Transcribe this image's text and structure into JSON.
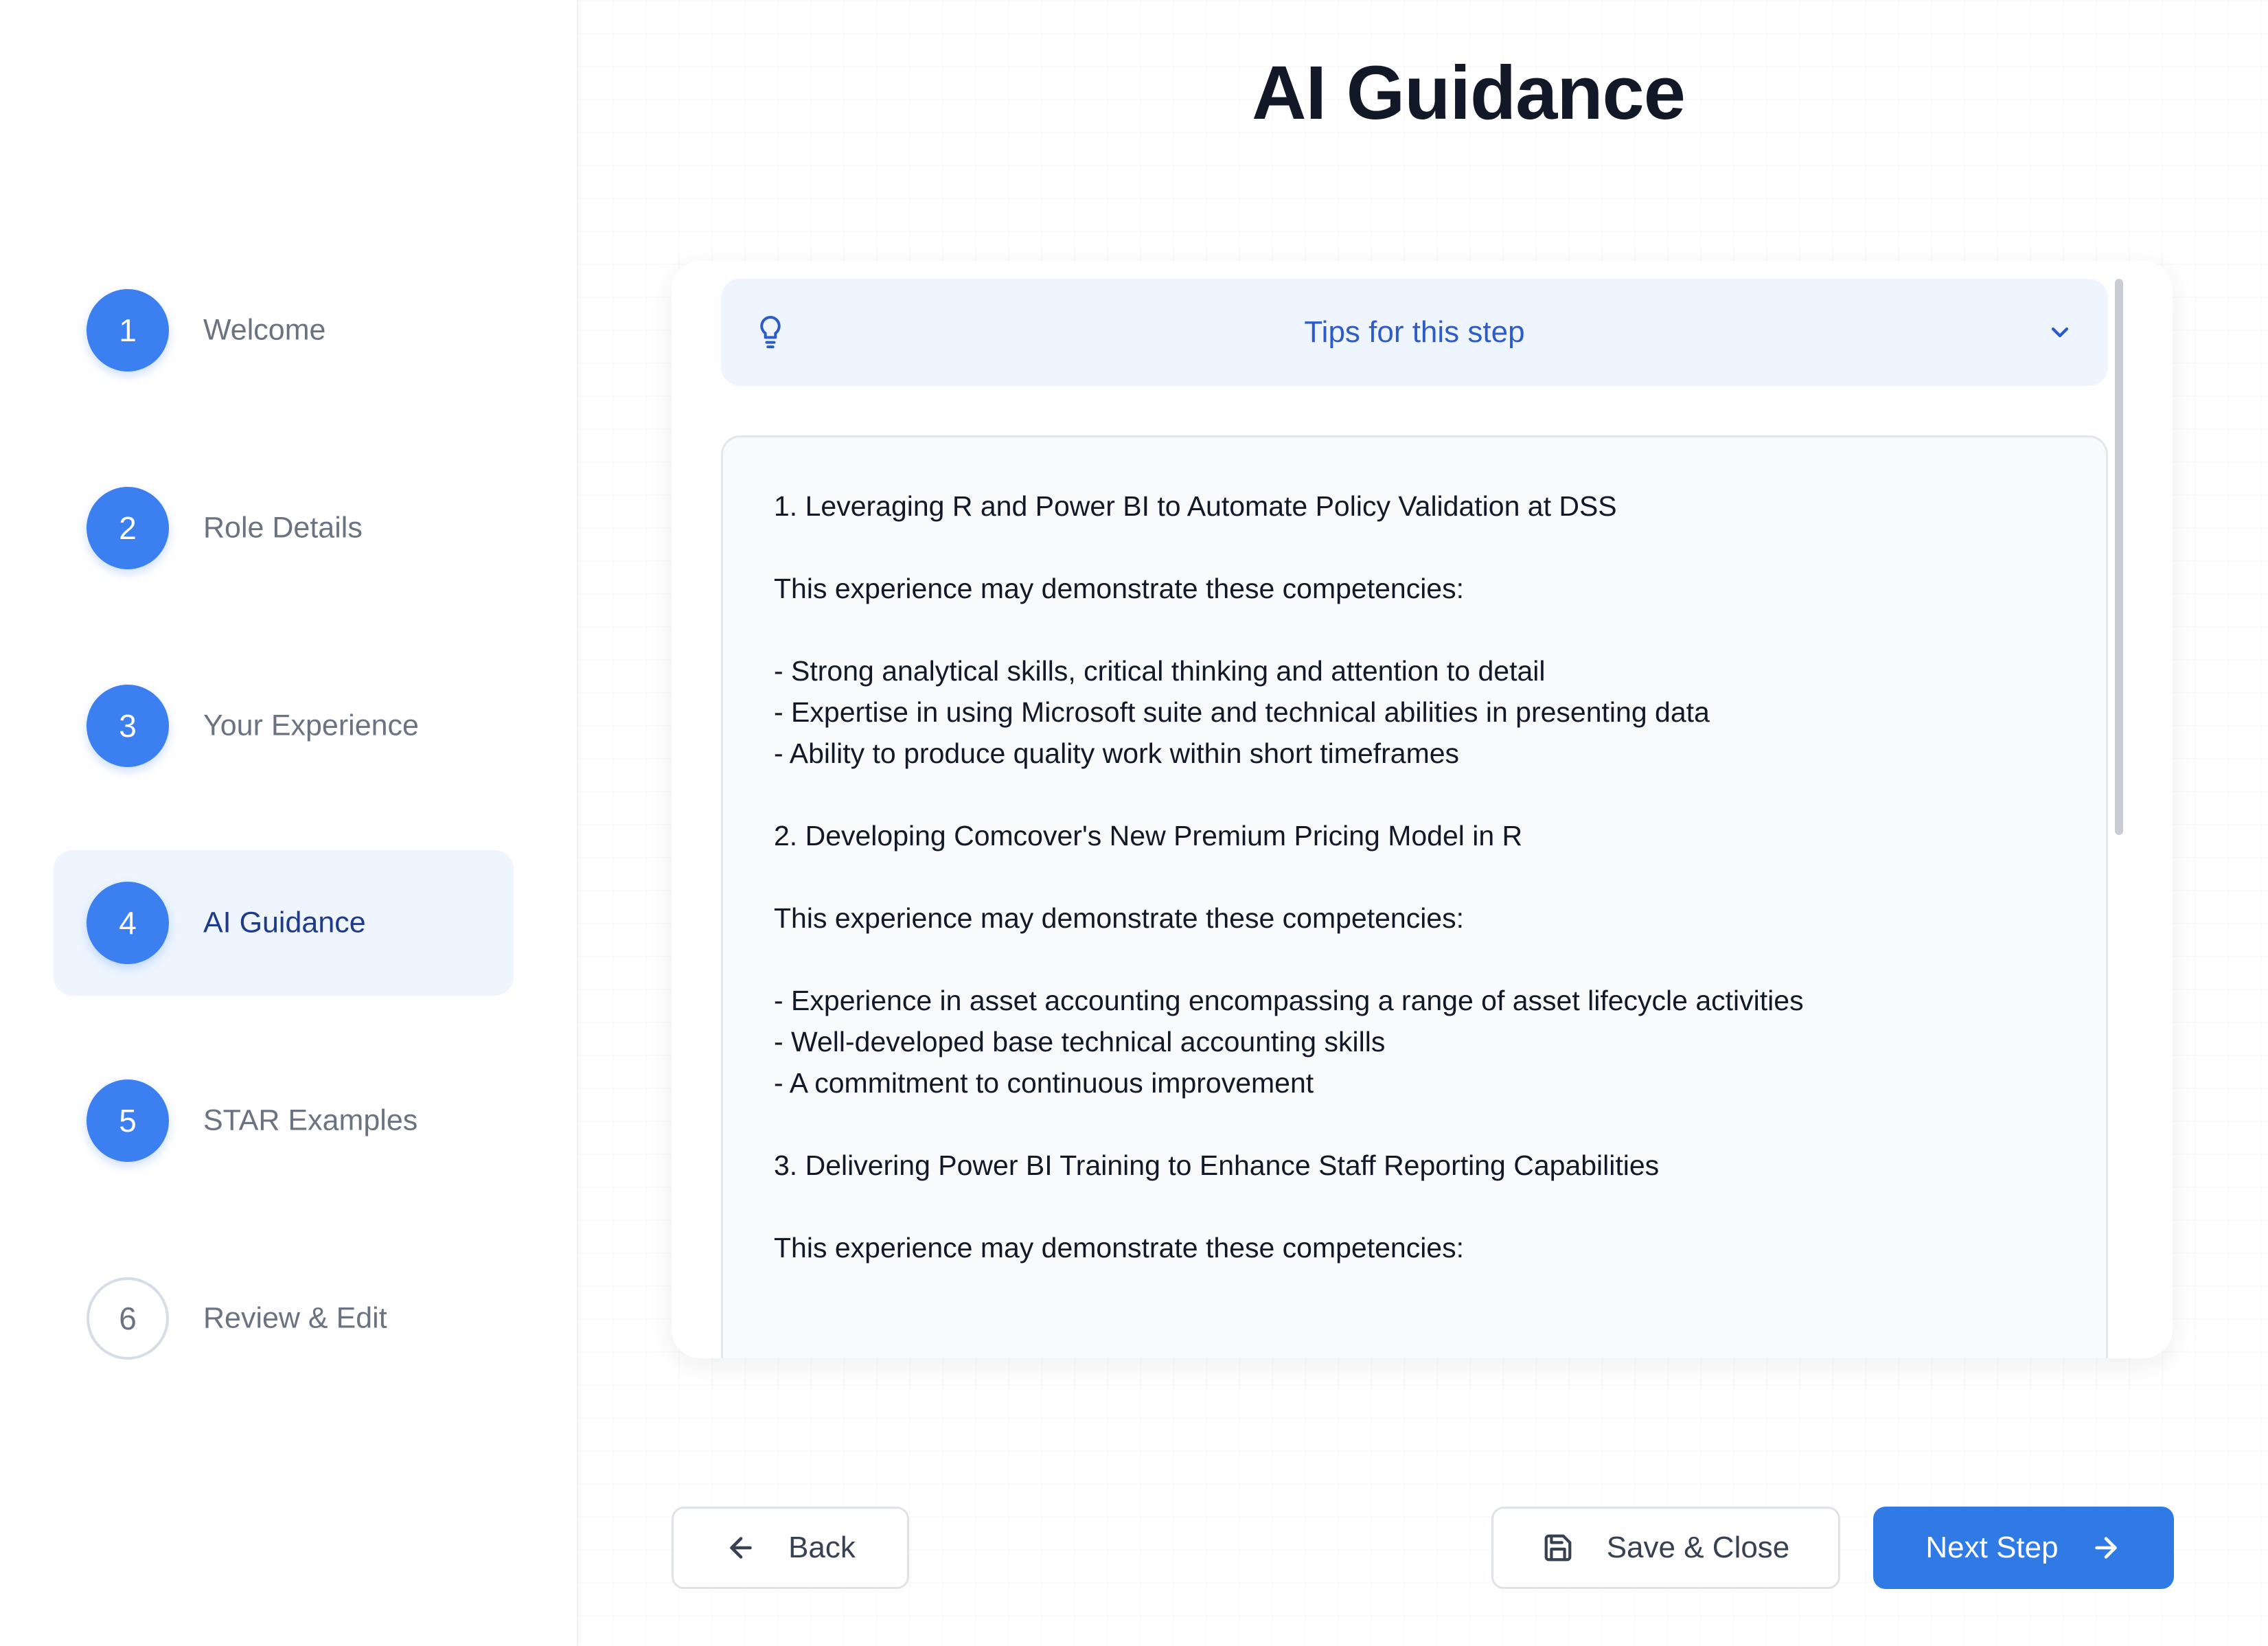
{
  "page": {
    "title": "AI Guidance"
  },
  "steps": [
    {
      "number": "1",
      "label": "Welcome",
      "status": "complete"
    },
    {
      "number": "2",
      "label": "Role Details",
      "status": "complete"
    },
    {
      "number": "3",
      "label": "Your Experience",
      "status": "complete"
    },
    {
      "number": "4",
      "label": "AI Guidance",
      "status": "active"
    },
    {
      "number": "5",
      "label": "STAR Examples",
      "status": "complete"
    },
    {
      "number": "6",
      "label": "Review & Edit",
      "status": "pending"
    }
  ],
  "tips": {
    "label": "Tips for this step",
    "icon": "lightbulb-icon",
    "expand_icon": "chevron-down-icon"
  },
  "guidance": {
    "text": "1. Leveraging R and Power BI to Automate Policy Validation at DSS\n\nThis experience may demonstrate these competencies:\n\n- Strong analytical skills, critical thinking and attention to detail\n- Expertise in using Microsoft suite and technical abilities in presenting data\n- Ability to produce quality work within short timeframes\n\n2. Developing Comcover's New Premium Pricing Model in R\n\nThis experience may demonstrate these competencies:\n\n- Experience in asset accounting encompassing a range of asset lifecycle activities\n- Well-developed base technical accounting skills\n- A commitment to continuous improvement\n\n3. Delivering Power BI Training to Enhance Staff Reporting Capabilities\n\nThis experience may demonstrate these competencies:"
  },
  "footer": {
    "back_label": "Back",
    "save_label": "Save & Close",
    "next_label": "Next Step"
  },
  "colors": {
    "accent": "#3b7ff0",
    "primary_button": "#2f7ae5",
    "active_step_bg": "#eef5ff",
    "tips_text": "#2d5cc9"
  }
}
